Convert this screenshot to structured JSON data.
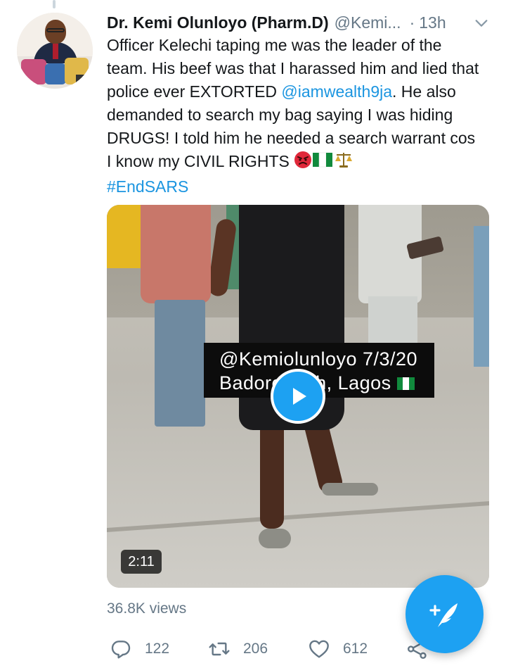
{
  "tweet": {
    "author_name": "Dr. Kemi Olunloyo (Pharm.D)",
    "author_handle": "@Kemi...",
    "separator": "·",
    "time": "13h",
    "text_part1": "Officer Kelechi taping me was the leader of the team. His beef was that I harassed him and lied that police ever EXTORTED ",
    "mention": "@iamwealth9ja",
    "text_part2": ". He also demanded to search my bag saying I was hiding DRUGS! I told him he needed a search warrant cos I know my CIVIL RIGHTS ",
    "hashtag": "#EndSARS",
    "emojis": [
      "angry-face",
      "nigeria-flag",
      "balance-scale"
    ]
  },
  "video": {
    "watermark_line1": "@Kemiolunloyo 7/3/20",
    "watermark_line2": "Badore Ajah, Lagos",
    "duration": "2:11"
  },
  "stats": {
    "views": "36.8K views",
    "replies": "122",
    "retweets": "206",
    "likes": "612"
  },
  "icons": {
    "reply": "reply-icon",
    "retweet": "retweet-icon",
    "like": "heart-icon",
    "share": "share-icon",
    "compose": "compose-tweet-icon",
    "more": "chevron-down-icon",
    "play": "play-icon"
  },
  "colors": {
    "accent": "#1da1f2",
    "link": "#1b95e0",
    "muted": "#657786",
    "text": "#14171a"
  }
}
